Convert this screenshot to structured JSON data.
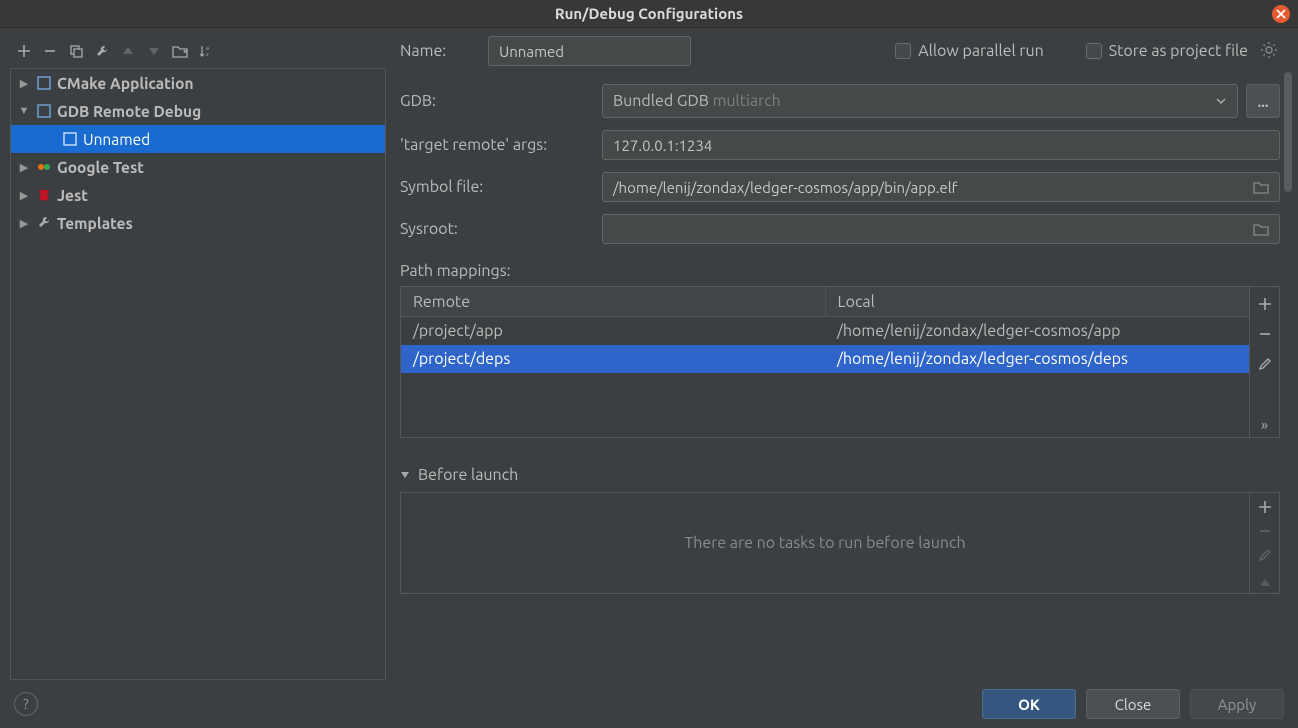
{
  "window": {
    "title": "Run/Debug Configurations"
  },
  "sidebar": {
    "items": [
      {
        "label": "CMake Application",
        "expanded": false,
        "icon": "cmake"
      },
      {
        "label": "GDB Remote Debug",
        "expanded": true,
        "icon": "gdb",
        "children": [
          {
            "label": "Unnamed",
            "selected": true
          }
        ]
      },
      {
        "label": "Google Test",
        "expanded": false,
        "icon": "gtest"
      },
      {
        "label": "Jest",
        "expanded": false,
        "icon": "jest"
      },
      {
        "label": "Templates",
        "expanded": false,
        "icon": "wrench"
      }
    ]
  },
  "form": {
    "name_label": "Name:",
    "name_value": "Unnamed",
    "allow_parallel_label": "Allow parallel run",
    "store_project_label": "Store as project file",
    "gdb_label": "GDB:",
    "gdb_value": "Bundled GDB",
    "gdb_suffix": "multiarch",
    "target_remote_label": "'target remote' args:",
    "target_remote_value": "127.0.0.1:1234",
    "symbol_file_label": "Symbol file:",
    "symbol_file_value": "/home/lenij/zondax/ledger-cosmos/app/bin/app.elf",
    "sysroot_label": "Sysroot:",
    "sysroot_value": "",
    "path_mappings_label": "Path mappings:",
    "path_mappings": {
      "headers": {
        "remote": "Remote",
        "local": "Local"
      },
      "rows": [
        {
          "remote": "/project/app",
          "local": "/home/lenij/zondax/ledger-cosmos/app",
          "selected": false
        },
        {
          "remote": "/project/deps",
          "local": "/home/lenij/zondax/ledger-cosmos/deps",
          "selected": true
        }
      ]
    },
    "before_launch_label": "Before launch",
    "before_launch_empty": "There are no tasks to run before launch"
  },
  "footer": {
    "ok": "OK",
    "close": "Close",
    "apply": "Apply"
  }
}
